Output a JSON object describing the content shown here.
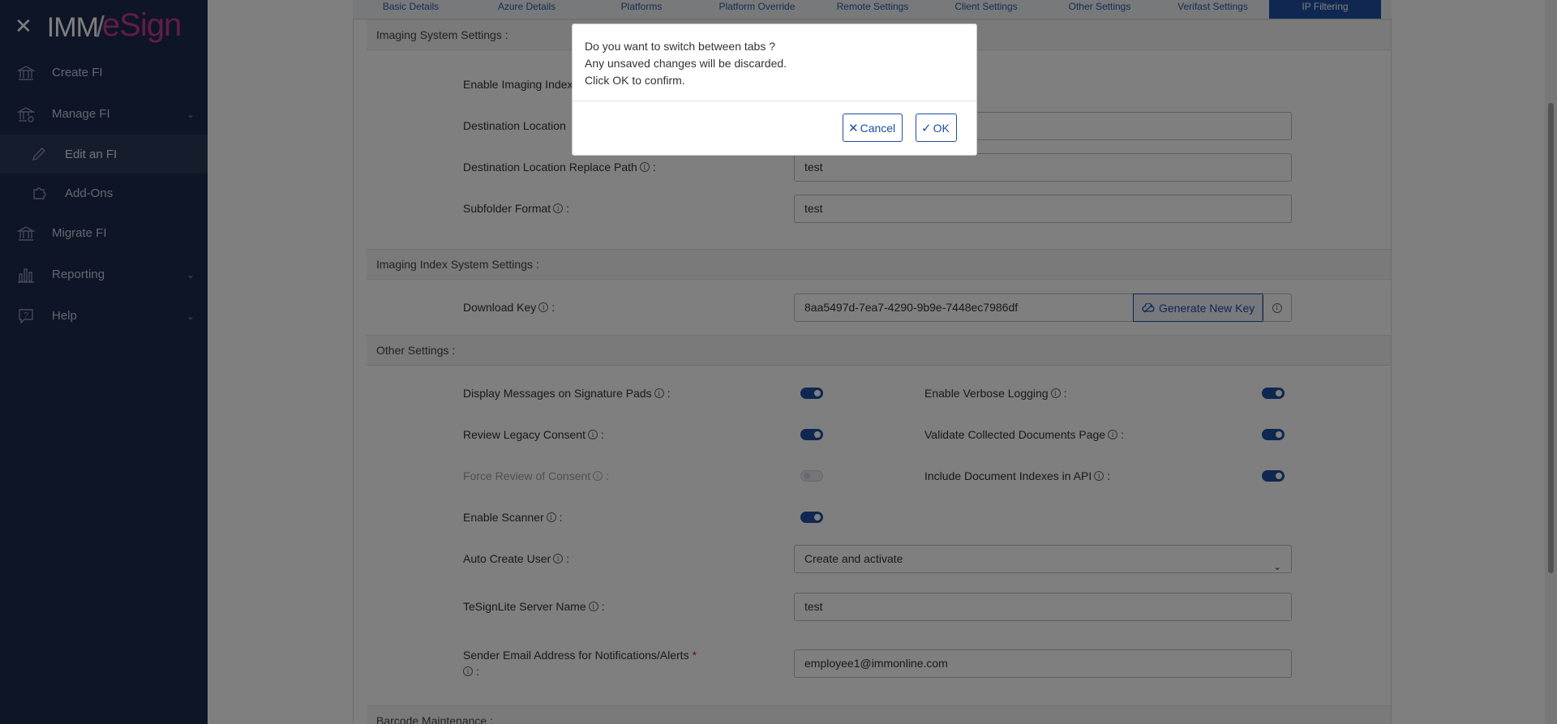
{
  "sidebar": {
    "logo": {
      "part1": "IMM",
      "part2": "eSign"
    },
    "items": [
      {
        "label": "Create FI",
        "icon": "bank-icon"
      },
      {
        "label": "Manage FI",
        "icon": "bank-gear-icon"
      },
      {
        "label": "Edit an FI",
        "icon": "pencil-icon"
      },
      {
        "label": "Add-Ons",
        "icon": "puzzle-icon"
      },
      {
        "label": "Migrate FI",
        "icon": "bank-icon"
      },
      {
        "label": "Reporting",
        "icon": "bar-chart-icon"
      },
      {
        "label": "Help",
        "icon": "help-chat-icon"
      }
    ]
  },
  "tabs": [
    "Basic Details",
    "Azure Details",
    "Platforms",
    "Platform Override",
    "Remote Settings",
    "Client Settings",
    "Other Settings",
    "Verifast Settings",
    "IP Filtering"
  ],
  "sections": {
    "imaging": {
      "title": "Imaging System Settings :",
      "enable_label": "Enable Imaging Index",
      "dest_location_label": "Destination Location",
      "dest_location_value": "",
      "replace_path_label": "Destination Location Replace Path",
      "replace_path_value": "test",
      "subfolder_label": "Subfolder Format",
      "subfolder_value": "test"
    },
    "index": {
      "title": "Imaging Index System Settings :",
      "download_key_label": "Download Key",
      "download_key_value": "8aa5497d-7ea7-4290-9b9e-7448ec7986df",
      "generate_label": "Generate New Key"
    },
    "other": {
      "title": "Other Settings :",
      "display_messages": "Display Messages on Signature Pads",
      "verbose_logging": "Enable Verbose Logging",
      "legacy_consent": "Review Legacy Consent",
      "validate_docs": "Validate Collected Documents Page",
      "force_review": "Force Review of Consent",
      "include_indexes": "Include Document Indexes in API",
      "enable_scanner": "Enable Scanner",
      "auto_create_user": "Auto Create User",
      "auto_create_value": "Create and activate",
      "server_name": "TeSignLite Server Name",
      "server_value": "test",
      "sender_email": "Sender Email Address for Notifications/Alerts",
      "sender_value": "employee1@immonline.com"
    },
    "barcode": {
      "title": "Barcode Maintenance :"
    }
  },
  "dialog": {
    "line1": "Do you want to switch between tabs ?",
    "line2": "Any unsaved changes will be discarded.",
    "line3": "Click OK to confirm.",
    "cancel": "Cancel",
    "ok": "OK"
  },
  "colon": ":",
  "required_mark": "*",
  "info_glyph": "i"
}
